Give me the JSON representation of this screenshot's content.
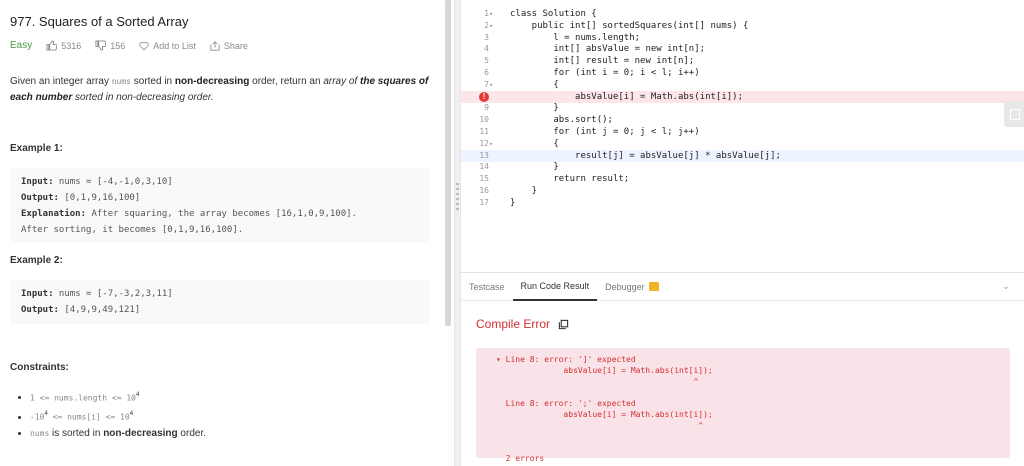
{
  "problem": {
    "title": "977. Squares of a Sorted Array",
    "difficulty": "Easy",
    "likes": "5316",
    "dislikes": "156",
    "add_to_list": "Add to List",
    "share": "Share",
    "desc_1": "Given an integer array ",
    "desc_code": "nums",
    "desc_2": " sorted in ",
    "desc_bold1": "non-decreasing",
    "desc_3": " order, return an ",
    "desc_italic1": "array of ",
    "desc_bold2": "the squares of each number",
    "desc_italic2": " sorted in non-decreasing order.",
    "example1": {
      "heading": "Example 1:",
      "input_label": "Input:",
      "input": " nums = [-4,-1,0,3,10]",
      "output_label": "Output:",
      "output": " [0,1,9,16,100]",
      "explanation_label": "Explanation:",
      "explanation": " After squaring, the array becomes [16,1,0,9,100].",
      "explanation2": "After sorting, it becomes [0,1,9,16,100]."
    },
    "example2": {
      "heading": "Example 2:",
      "input_label": "Input:",
      "input": " nums = [-7,-3,2,3,11]",
      "output_label": "Output:",
      "output": " [4,9,9,49,121]"
    },
    "constraints_heading": "Constraints:",
    "constraints": {
      "c1_code": "1 <= nums.length <= 10",
      "c1_sup": "4",
      "c2_code_a": "-10",
      "c2_sup": "4",
      "c2_code_b": " <= nums[i] <= 10",
      "c2_sup2": "4",
      "c3_code": "nums",
      "c3_text": " is sorted in ",
      "c3_bold": "non-decreasing",
      "c3_end": " order."
    }
  },
  "editor": {
    "lines": [
      {
        "n": "1",
        "fold": "▾",
        "code": "class Solution {"
      },
      {
        "n": "2",
        "fold": "▾",
        "code": "    public int[] sortedSquares(int[] nums) {"
      },
      {
        "n": "3",
        "fold": "",
        "code": "        l = nums.length;"
      },
      {
        "n": "4",
        "fold": "",
        "code": "        int[] absValue = new int[n];"
      },
      {
        "n": "5",
        "fold": "",
        "code": "        int[] result = new int[n];"
      },
      {
        "n": "6",
        "fold": "",
        "code": "        for (int i = 0; i < l; i++)"
      },
      {
        "n": "7",
        "fold": "▾",
        "code": "        {"
      },
      {
        "n": "",
        "fold": "",
        "code": "            absValue[i] = Math.abs(int[i]);"
      },
      {
        "n": "9",
        "fold": "",
        "code": "        }"
      },
      {
        "n": "10",
        "fold": "",
        "code": "        abs.sort();"
      },
      {
        "n": "11",
        "fold": "",
        "code": "        for (int j = 0; j < l; j++)"
      },
      {
        "n": "12",
        "fold": "▾",
        "code": "        {"
      },
      {
        "n": "13",
        "fold": "",
        "code": "            result[j] = absValue[j] * absValue[j];"
      },
      {
        "n": "14",
        "fold": "",
        "code": "        }"
      },
      {
        "n": "15",
        "fold": "",
        "code": "        return result;"
      },
      {
        "n": "16",
        "fold": "",
        "code": "    }"
      },
      {
        "n": "17",
        "fold": "",
        "code": "}"
      }
    ],
    "error_marker": "!"
  },
  "console": {
    "tabs": [
      "Testcase",
      "Run Code Result",
      "Debugger"
    ],
    "active_tab": 1,
    "result_title": "Compile Error",
    "errors": "▾ Line 8: error: ']' expected\n              absValue[i] = Math.abs(int[i]);\n                                         ^\n\n  Line 8: error: ';' expected\n              absValue[i] = Math.abs(int[i]);\n                                          ^\n\n\n  2 errors"
  },
  "colors": {
    "easy": "#43a047",
    "error": "#d32f2f",
    "error_bg": "#f9e3e8",
    "lock": "#f0b429"
  }
}
